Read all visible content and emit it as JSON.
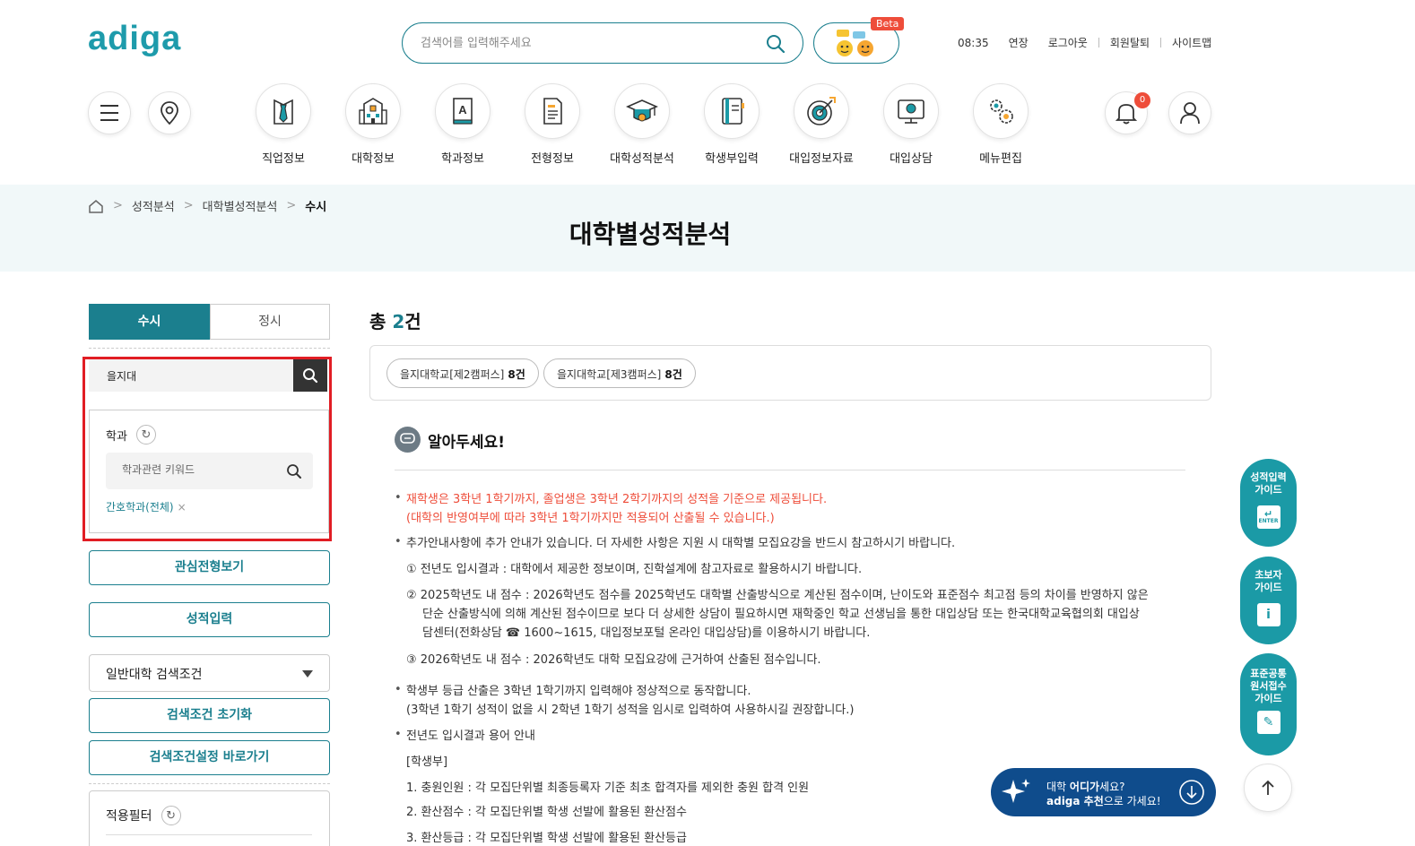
{
  "header": {
    "logo": "adiga",
    "search_placeholder": "검색어를 입력해주세요",
    "beta_label": "Beta",
    "time": "08:35",
    "links": [
      "연장",
      "로그아웃",
      "회원탈퇴",
      "사이트맵"
    ],
    "notification_count": "0"
  },
  "nav": [
    {
      "label": "직업정보",
      "icon": "necktie-icon"
    },
    {
      "label": "대학정보",
      "icon": "building-icon"
    },
    {
      "label": "학과정보",
      "icon": "book-icon"
    },
    {
      "label": "전형정보",
      "icon": "document-icon"
    },
    {
      "label": "대학성적분석",
      "icon": "graduation-cap-icon"
    },
    {
      "label": "학생부입력",
      "icon": "notebook-icon"
    },
    {
      "label": "대입정보자료",
      "icon": "target-icon"
    },
    {
      "label": "대입상담",
      "icon": "monitor-icon"
    },
    {
      "label": "메뉴편집",
      "icon": "gear-icon"
    }
  ],
  "breadcrumb": [
    "성적분석",
    "대학별성적분석",
    "수시"
  ],
  "page_title": "대학별성적분석",
  "left": {
    "tabs": [
      "수시",
      "정시"
    ],
    "university_value": "을지대",
    "dept_label": "학과",
    "dept_placeholder": "학과관련 키워드",
    "dept_tag": "간호학과(전체)",
    "btn_interest": "관심전형보기",
    "btn_grade_input": "성적입력",
    "select_value": "일반대학 검색조건",
    "btn_reset": "검색조건 초기화",
    "btn_goto": "검색조건설정 바로가기",
    "filter_label": "적용필터"
  },
  "results": {
    "total_prefix": "총",
    "total_count": "2",
    "total_suffix": "건",
    "chips": [
      {
        "name": "을지대학교[제2캠퍼스]",
        "count": "8건"
      },
      {
        "name": "을지대학교[제3캠퍼스]",
        "count": "8건"
      }
    ]
  },
  "notice": {
    "title": "알아두세요!",
    "lines": [
      "재학생은 3학년 1학기까지, 졸업생은 3학년 2학기까지의 성적을 기준으로 제공됩니다.",
      "(대학의 반영여부에 따라 3학년 1학기까지만 적용되어 산출될 수 있습니다.)",
      "추가안내사항에 추가 안내가 있습니다. 더 자세한 사항은 지원 시 대학별 모집요강을 반드시 참고하시기 바랍니다.",
      "① 전년도 입시결과 : 대학에서 제공한 정보이며, 진학설계에 참고자료로 활용하시기 바랍니다.",
      "② 2025학년도 내 점수 : 2026학년도 점수를 2025학년도 대학별 산출방식으로 계산된 점수이며, 난이도와 표준점수 최고점 등의 차이를 반영하지 않은",
      "단순 산출방식에 의해 계산된 점수이므로 보다 더 상세한 상담이 필요하시면 재학중인 학교 선생님을 통한 대입상담 또는 한국대학교육협의회 대입상",
      "담센터(전화상담 ☎ 1600~1615, 대입정보포털 온라인 대입상담)를 이용하시기 바랍니다.",
      "③ 2026학년도 내 점수 : 2026학년도 대학 모집요강에 근거하여 산출된 점수입니다.",
      "학생부 등급 산출은 3학년 1학기까지 입력해야 정상적으로 동작합니다.",
      "(3학년 1학기 성적이 없을 시 2학년 1학기 성적을 임시로 입력하여 사용하시길 권장합니다.)",
      "전년도 입시결과 용어 안내",
      "[학생부]",
      "1. 충원인원 : 각 모집단위별 최종등록자 기준 최초 합격자를 제외한 충원 합격 인원",
      "2. 환산점수 : 각 모집단위별 학생 선발에 활용된 환산점수",
      "3. 환산등급 : 각 모집단위별 학생 선발에 활용된 환산등급"
    ]
  },
  "float": {
    "fab1": [
      "성적입력",
      "가이드"
    ],
    "fab1_icon": "ENTER",
    "fab2": [
      "초보자",
      "가이드"
    ],
    "fab3": [
      "표준공통",
      "원서접수",
      "가이드"
    ],
    "reco_pre": "대학 ",
    "reco_bold1": "어디가",
    "reco_post1": "세요?",
    "reco_bold2": "adiga 추천",
    "reco_post2": "으로 가세요!"
  }
}
